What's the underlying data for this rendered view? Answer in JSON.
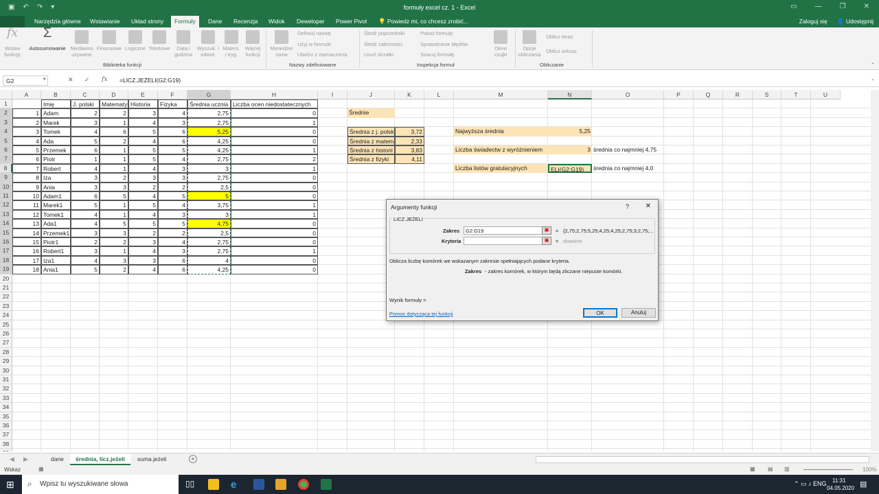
{
  "window": {
    "title": "formuły excel cz. 1 - Excel"
  },
  "ribbon_tabs": {
    "file": "Plik",
    "home": "Narzędzia główne",
    "insert": "Wstawianie",
    "layout": "Układ strony",
    "formulas": "Formuły",
    "data": "Dane",
    "review": "Recenzja",
    "view": "Widok",
    "developer": "Deweloper",
    "powerpivot": "Power Pivot",
    "tellme": "Powiedz mi, co chcesz zrobić...",
    "signin": "Zaloguj się",
    "share": "Udostępnij"
  },
  "ribbon": {
    "insert_fn": [
      "Wstaw",
      "funkcję"
    ],
    "autosum": "Autosumowanie",
    "recent": [
      "Niedawno",
      "używane"
    ],
    "financial": "Finansowe",
    "logical": "Logiczne",
    "text": "Tekstowe",
    "datetime": [
      "Data i",
      "godzina"
    ],
    "lookup": [
      "Wyszuk. i",
      "odwoł."
    ],
    "math": [
      "Matem.",
      "i tryg."
    ],
    "more": [
      "Więcej",
      "funkcji"
    ],
    "group_library": "Biblioteka funkcji",
    "name_manager": [
      "Menedżer",
      "nazw"
    ],
    "define_name": "Definiuj nazwę",
    "use_in_formula": "Użyj w formule",
    "create_from_sel": "Utwórz z zaznaczenia",
    "group_names": "Nazwy zdefiniowane",
    "trace_prec": "Śledź poprzedniki",
    "trace_dep": "Śledź zależności",
    "remove_arrows": "Usuń strzałki",
    "show_formulas": "Pokaż formuły",
    "error_check": "Sprawdzanie błędów",
    "evaluate": "Szacuj formułę",
    "group_audit": "Inspekcja formuł",
    "watch": [
      "Okno",
      "czujki"
    ],
    "calc_options": [
      "Opcje",
      "obliczania"
    ],
    "calc_now": "Oblicz teraz",
    "calc_sheet": "Oblicz arkusz",
    "group_calc": "Obliczanie"
  },
  "formula_bar": {
    "name_box": "G2",
    "formula": "=LICZ.JEŻELI(G2:G19)"
  },
  "columns": [
    "A",
    "B",
    "C",
    "D",
    "E",
    "F",
    "G",
    "H",
    "I",
    "J",
    "K",
    "L",
    "M",
    "N",
    "O",
    "P",
    "Q",
    "R",
    "S",
    "T",
    "U"
  ],
  "rows": [
    "1",
    "2",
    "3",
    "4",
    "5",
    "6",
    "7",
    "8",
    "9",
    "10",
    "11",
    "12",
    "13",
    "14",
    "15",
    "16",
    "17",
    "18",
    "19",
    "20",
    "21",
    "22",
    "23",
    "24",
    "25",
    "26",
    "27",
    "28",
    "29",
    "30",
    "31",
    "32",
    "33",
    "34",
    "35",
    "36",
    "37",
    "38",
    "39"
  ],
  "table": {
    "headers": [
      "Imię",
      "J. polski",
      "Matematyka",
      "Historia",
      "Fizyka",
      "Średnia ucznia",
      "Liczba ocen niedostatecznych"
    ],
    "rows": [
      [
        "1",
        "Adam",
        "2",
        "2",
        "3",
        "4",
        "2,75",
        "0"
      ],
      [
        "2",
        "Marek",
        "3",
        "1",
        "4",
        "3",
        "2,75",
        "1"
      ],
      [
        "3",
        "Tomek",
        "4",
        "6",
        "5",
        "6",
        "5,25",
        "0"
      ],
      [
        "4",
        "Ada",
        "5",
        "2",
        "4",
        "6",
        "4,25",
        "0"
      ],
      [
        "5",
        "Przemek",
        "6",
        "1",
        "5",
        "5",
        "4,25",
        "1"
      ],
      [
        "6",
        "Piotr",
        "1",
        "1",
        "5",
        "4",
        "2,75",
        "2"
      ],
      [
        "7",
        "Robert",
        "4",
        "1",
        "4",
        "3",
        "3",
        "1"
      ],
      [
        "8",
        "Iza",
        "3",
        "2",
        "3",
        "3",
        "2,75",
        "0"
      ],
      [
        "9",
        "Ania",
        "3",
        "3",
        "2",
        "2",
        "2,5",
        "0"
      ],
      [
        "10",
        "Adam1",
        "6",
        "5",
        "4",
        "5",
        "5",
        "0"
      ],
      [
        "11",
        "Marek1",
        "5",
        "1",
        "5",
        "4",
        "3,75",
        "1"
      ],
      [
        "12",
        "Tomek1",
        "4",
        "1",
        "4",
        "3",
        "3",
        "1"
      ],
      [
        "13",
        "Ada1",
        "4",
        "5",
        "5",
        "5",
        "4,75",
        "0"
      ],
      [
        "14",
        "Przemek1",
        "3",
        "3",
        "2",
        "2",
        "2,5",
        "0"
      ],
      [
        "15",
        "Piotr1",
        "2",
        "2",
        "3",
        "4",
        "2,75",
        "0"
      ],
      [
        "16",
        "Robert1",
        "3",
        "1",
        "4",
        "3",
        "2,75",
        "1"
      ],
      [
        "17",
        "Iza1",
        "4",
        "3",
        "3",
        "6",
        "4",
        "0"
      ],
      [
        "18",
        "Ania1",
        "5",
        "2",
        "4",
        "6",
        "4,25",
        "0"
      ]
    ],
    "highlight_rows": [
      3,
      10,
      13
    ]
  },
  "averages": {
    "title": "Średnie",
    "labels": [
      "Średnia z j. polskiego",
      "Średnia z matematyki",
      "Średnia z historii",
      "Średnia z fizyki"
    ],
    "values": [
      "3,72",
      "2,33",
      "3,83",
      "4,11"
    ]
  },
  "stats": {
    "max_label": "Najwyższa średnia",
    "max_value": "5,25",
    "distinction_label": "Liczba świadectw z wyróżnieniem",
    "distinction_value": "3",
    "distinction_note": "średnia co najmniej 4,75",
    "letters_label": "Liczba listów gratulacyjnych",
    "letters_value": "ELI(G2:G19)",
    "letters_note": "średnia co najmniej 4,0"
  },
  "dialog": {
    "title": "Argumenty funkcji",
    "help": "?",
    "close": "✕",
    "function": "LICZ.JEŻELI",
    "range_label": "Zakres",
    "range_value": "G2:G19",
    "range_result": "{2,75;2,75;5,25;4,25;4,25;2,75;3;2,75;...",
    "criteria_label": "Kryteria",
    "criteria_value": "",
    "criteria_result": "dowolne",
    "equals": "=",
    "description": "Oblicza liczbę komórek we wskazanym zakresie spełniających podane kryteria.",
    "arg_desc_name": "Zakres",
    "arg_desc": "- zakres komórek, w którym będą zliczane niepuste komórki.",
    "result": "Wynik formuły =",
    "help_link": "Pomoc dotycząca tej funkcji",
    "ok": "OK",
    "cancel": "Anuluj"
  },
  "sheets": {
    "tabs": [
      "dane",
      "średnia, licz.jeżeli",
      "suma.jeżeli"
    ],
    "active": 1
  },
  "status": {
    "mode": "Wskaz",
    "zoom": "100%"
  },
  "taskbar": {
    "search_placeholder": "Wpisz tu wyszukiwane słowa",
    "time": "11:31",
    "date": "04.05.2020"
  },
  "colors": {
    "excel_green": "#217346",
    "highlight": "#ffff00",
    "peach": "#fce4b6"
  }
}
